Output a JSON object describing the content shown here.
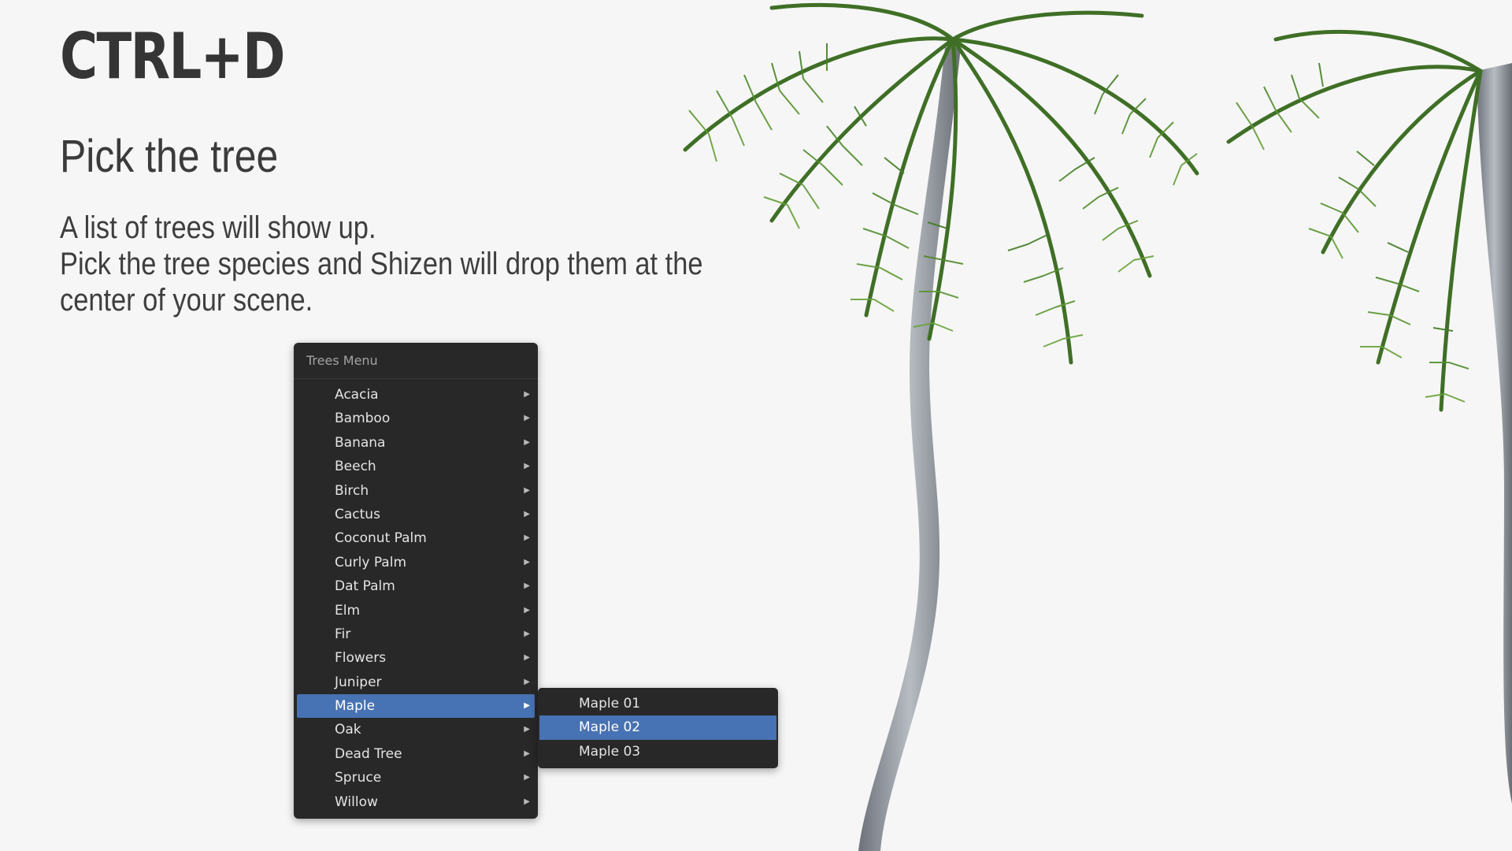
{
  "hero": {
    "shortcut": "CTRL+D",
    "subtitle": "Pick the tree",
    "description": [
      "A list of trees will show up.",
      "Pick the tree species and Shizen will drop them at the",
      "center of your scene."
    ]
  },
  "menu": {
    "title": "Trees Menu",
    "items": [
      {
        "label": "Acacia"
      },
      {
        "label": "Bamboo"
      },
      {
        "label": "Banana"
      },
      {
        "label": "Beech"
      },
      {
        "label": "Birch"
      },
      {
        "label": "Cactus"
      },
      {
        "label": "Coconut Palm"
      },
      {
        "label": "Curly Palm"
      },
      {
        "label": "Dat Palm"
      },
      {
        "label": "Elm"
      },
      {
        "label": "Fir"
      },
      {
        "label": "Flowers"
      },
      {
        "label": "Juniper"
      },
      {
        "label": "Maple"
      },
      {
        "label": "Oak"
      },
      {
        "label": "Dead Tree"
      },
      {
        "label": "Spruce"
      },
      {
        "label": "Willow"
      }
    ],
    "highlighted_item": "Maple",
    "arrow_glyph": "▶"
  },
  "submenu": {
    "items": [
      {
        "label": "Maple 01"
      },
      {
        "label": "Maple 02"
      },
      {
        "label": "Maple 03"
      }
    ],
    "highlighted_item": "Maple 02"
  },
  "colors": {
    "background": "#f6f6f6",
    "menu_bg": "#282828",
    "highlight": "#4772b3",
    "palm_trunk": "#8a8f96",
    "palm_leaf": "#4f8a2c"
  },
  "illustration": {
    "icon": "palm-tree-icon"
  }
}
